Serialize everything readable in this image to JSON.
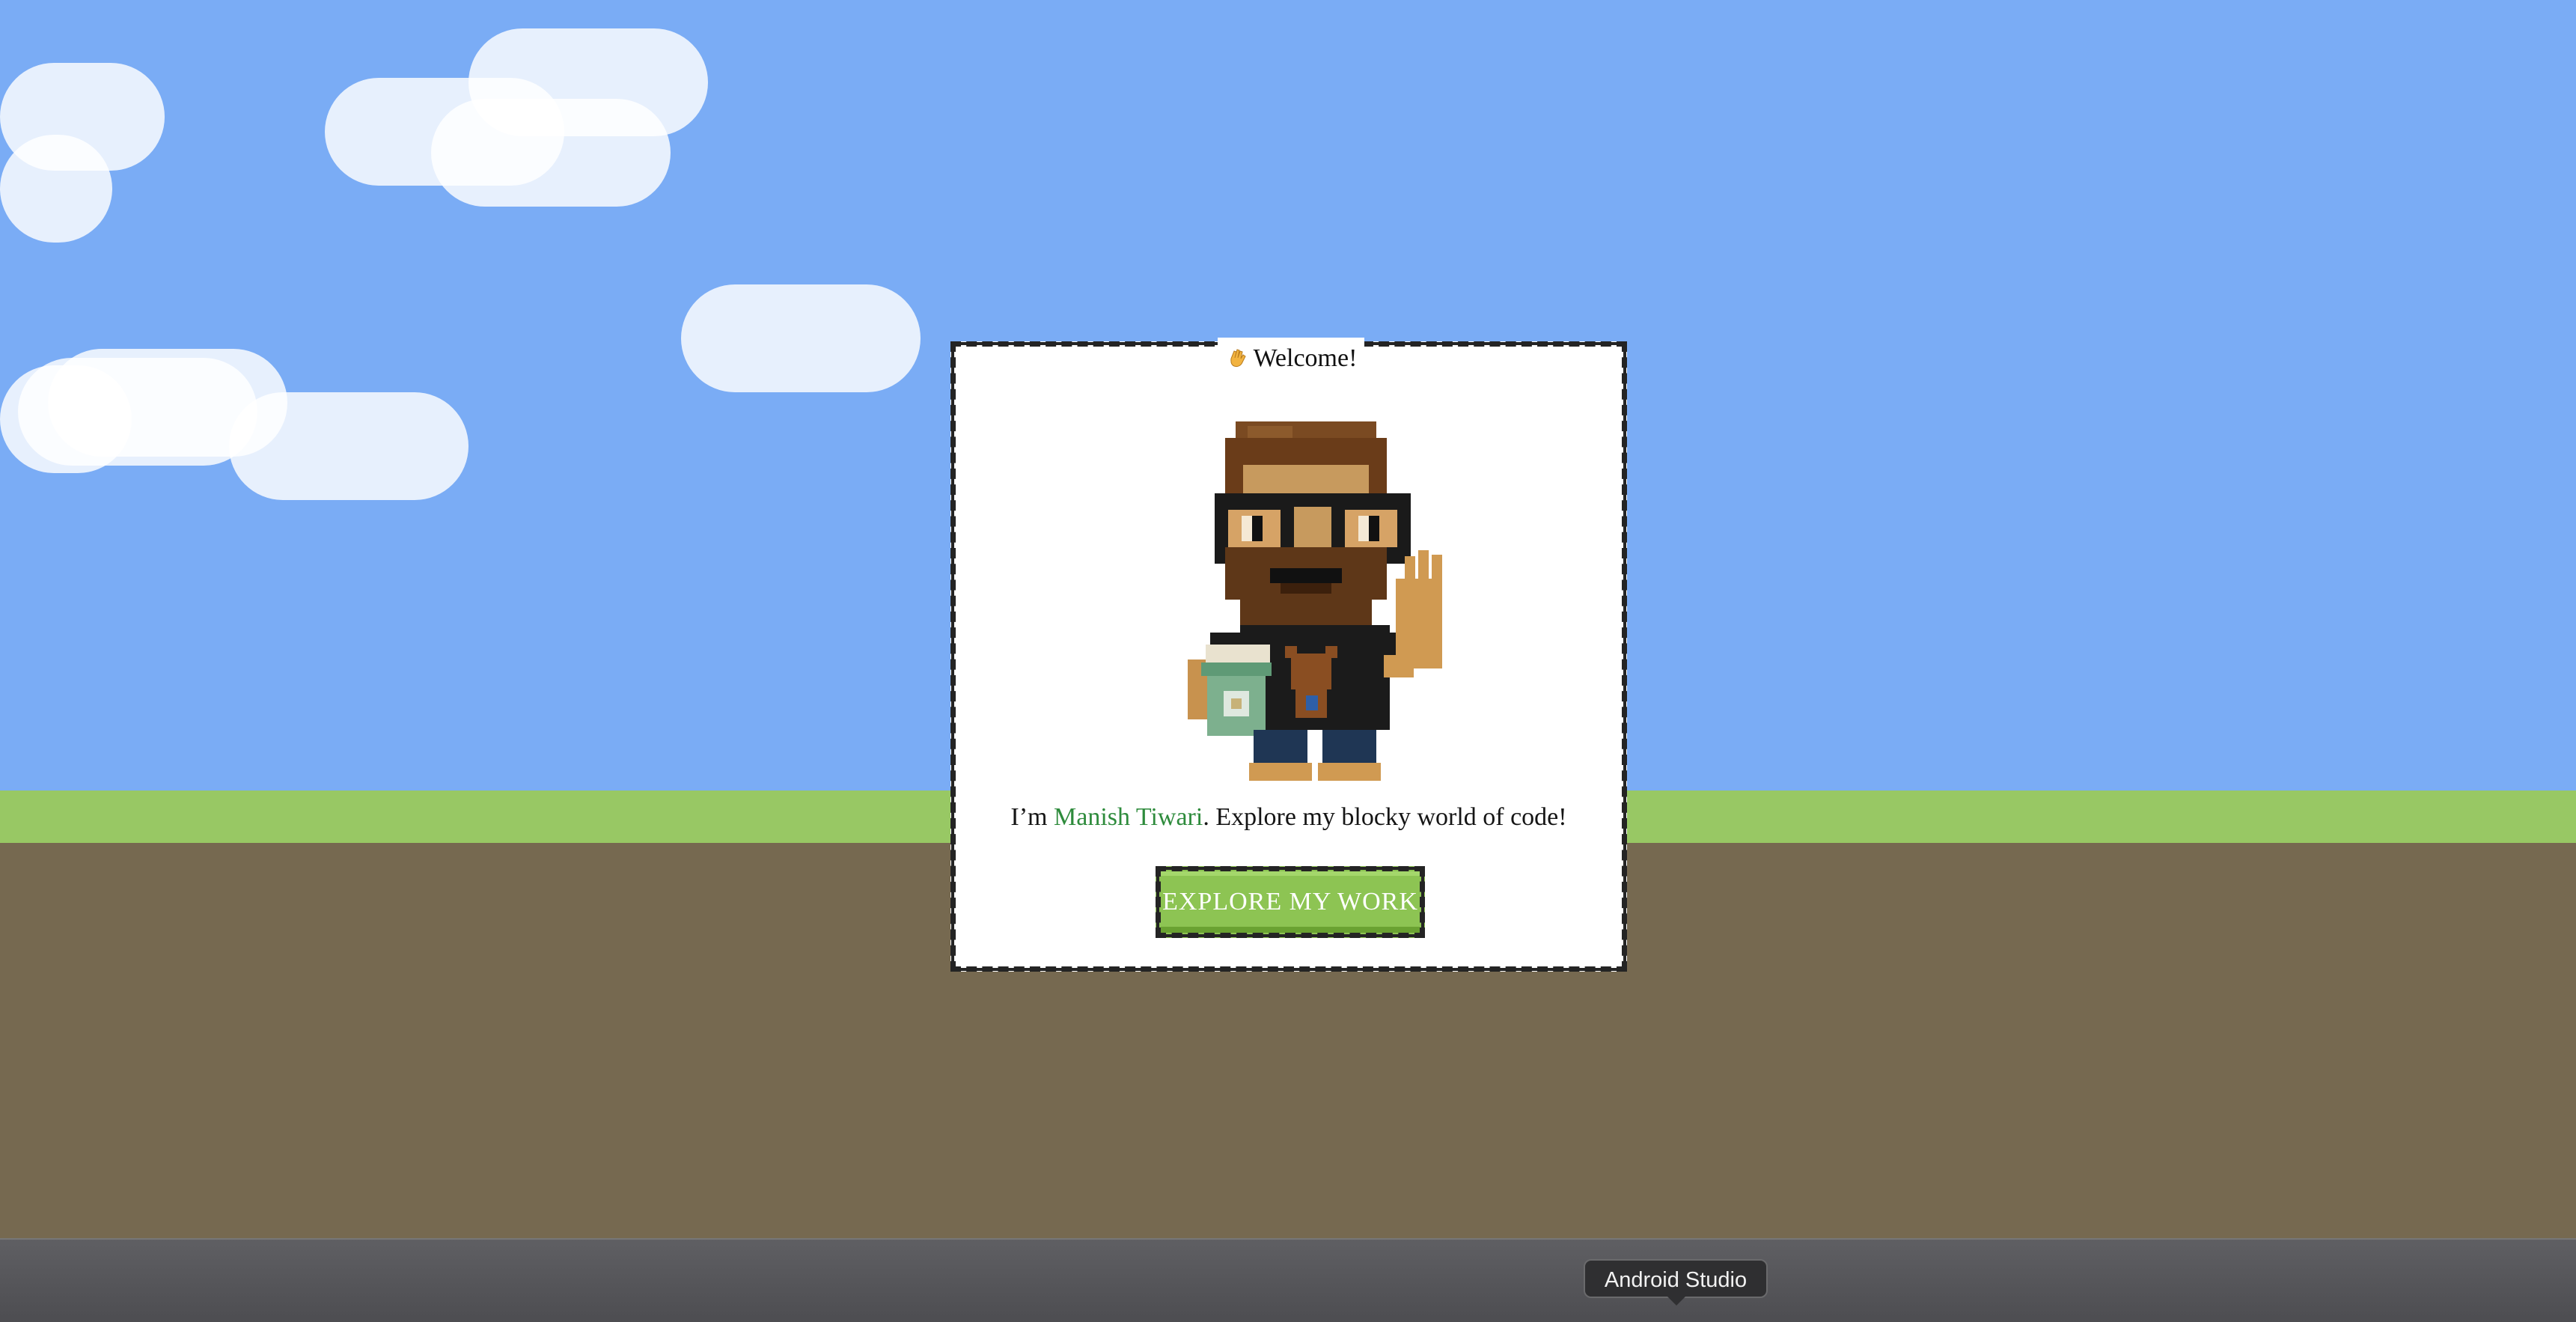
{
  "scene": {
    "sky_color": "#7aacf5",
    "grass_color": "#98c864",
    "dirt_color": "#766950"
  },
  "dialog": {
    "title_emoji": "waving-hand-icon",
    "title": "Welcome!",
    "intro_prefix": "I’m ",
    "name": "Manish Tiwari",
    "intro_suffix": ". Explore my blocky world of code!",
    "name_color": "#2e8b3c"
  },
  "cta": {
    "label": "EXPLORE MY WORK",
    "color": "#8dc453"
  },
  "dock": {
    "tooltip": "Android Studio"
  }
}
